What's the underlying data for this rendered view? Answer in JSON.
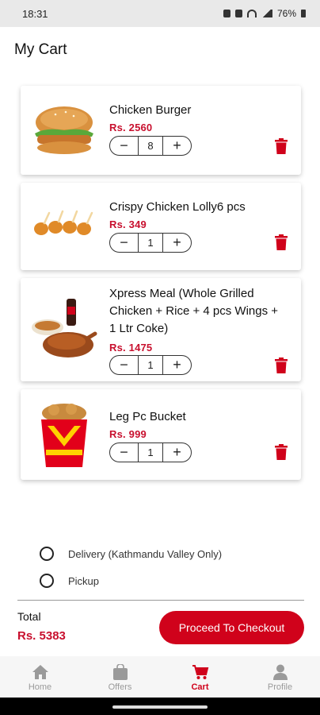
{
  "status_bar": {
    "time": "18:31",
    "battery": "76%"
  },
  "page": {
    "title": "My Cart"
  },
  "cart": {
    "items": [
      {
        "name": "Chicken Burger",
        "price": "Rs. 2560",
        "qty": "8"
      },
      {
        "name": "Crispy Chicken Lolly6 pcs",
        "price": "Rs. 349",
        "qty": "1"
      },
      {
        "name": "Xpress Meal (Whole Grilled Chicken + Rice + 4 pcs Wings + 1 Ltr Coke)",
        "price": "Rs. 1475",
        "qty": "1"
      },
      {
        "name": "Leg Pc Bucket",
        "price": "Rs. 999",
        "qty": "1"
      }
    ],
    "stepper": {
      "minus": "−",
      "plus": "+"
    }
  },
  "delivery_options": [
    {
      "label": "Delivery (Kathmandu Valley Only)",
      "selected": false
    },
    {
      "label": "Pickup",
      "selected": false
    }
  ],
  "summary": {
    "total_label": "Total",
    "total_value": "Rs. 5383",
    "checkout_label": "Proceed To Checkout"
  },
  "nav": {
    "items": [
      {
        "label": "Home",
        "icon": "home-icon",
        "active": false
      },
      {
        "label": "Offers",
        "icon": "bag-icon",
        "active": false
      },
      {
        "label": "Cart",
        "icon": "cart-icon",
        "active": true
      },
      {
        "label": "Profile",
        "icon": "profile-icon",
        "active": false
      }
    ]
  },
  "colors": {
    "accent": "#d0021b",
    "price": "#c8102e"
  }
}
